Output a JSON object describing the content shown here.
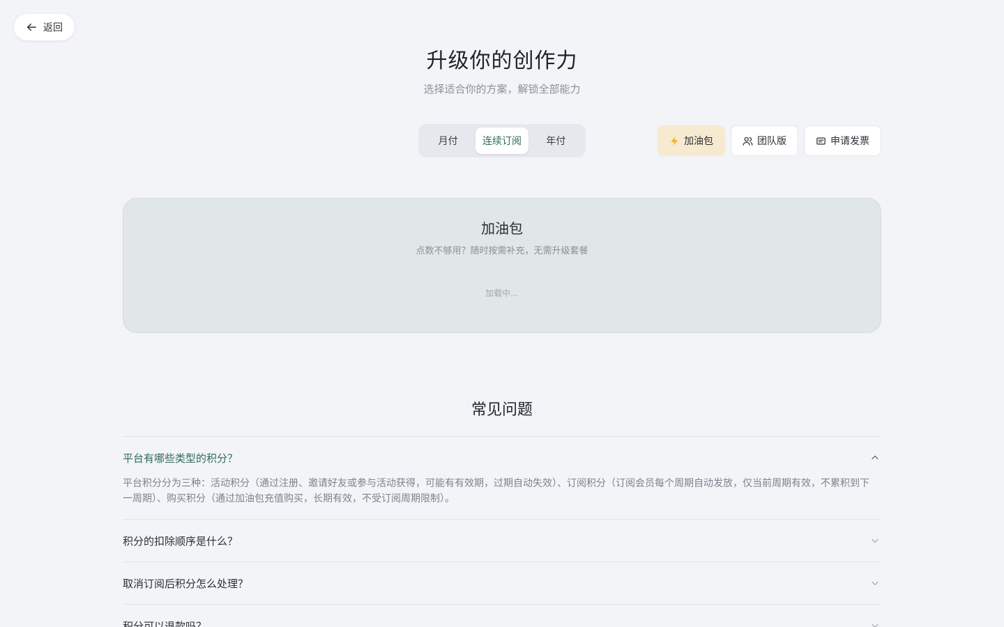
{
  "header": {
    "back_label": "返回",
    "title": "升级你的创作力",
    "subtitle": "选择适合你的方案，解锁全部能力"
  },
  "billing": {
    "options": [
      "月付",
      "连续订阅",
      "年付"
    ],
    "selected": "连续订阅"
  },
  "actions": {
    "booster_label": "加油包",
    "team_label": "团队版",
    "invoice_label": "申请发票"
  },
  "booster_card": {
    "title": "加油包",
    "description": "点数不够用？随时按需补充，无需升级套餐",
    "loading_text": "加载中..."
  },
  "faq": {
    "title": "常见问题",
    "items": [
      {
        "question": "平台有哪些类型的积分？",
        "answer": "平台积分分为三种：活动积分（通过注册、邀请好友或参与活动获得，可能有有效期，过期自动失效）、订阅积分（订阅会员每个周期自动发放，仅当前周期有效，不累积到下一周期）、购买积分（通过加油包充值购买，长期有效，不受订阅周期限制）。",
        "expanded": true
      },
      {
        "question": "积分的扣除顺序是什么？",
        "expanded": false
      },
      {
        "question": "取消订阅后积分怎么处理？",
        "expanded": false
      },
      {
        "question": "积分可以退款吗？",
        "expanded": false
      }
    ]
  },
  "colors": {
    "accent": "#2f6b52",
    "background": "#f3f4f8",
    "booster_bg": "#f6ead0",
    "booster_icon": "#f2b01e",
    "card_bg": "#e1e7e7"
  }
}
